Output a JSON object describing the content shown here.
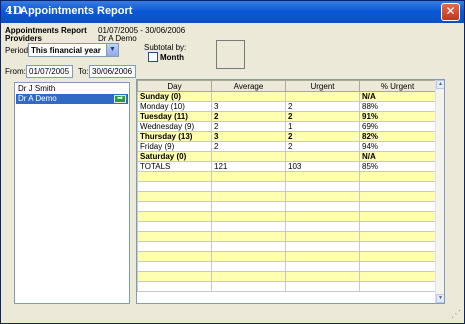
{
  "window": {
    "title": "Appointments Report",
    "logo": "4D"
  },
  "report": {
    "heading": "Appointments Report",
    "date_range": "01/07/2005 - 30/06/2006",
    "providers_label": "Providers",
    "providers_value": "Dr A Demo"
  },
  "period": {
    "label": "Period:",
    "value": "This financial year"
  },
  "subtotal": {
    "label": "Subtotal by:",
    "option": "Month"
  },
  "from": {
    "label": "From:",
    "value": "01/07/2005"
  },
  "to": {
    "label": "To:",
    "value": "30/06/2006"
  },
  "providers": [
    {
      "name": "Dr J Smith",
      "selected": false
    },
    {
      "name": "Dr A Demo",
      "selected": true
    }
  ],
  "grid": {
    "columns": [
      "Day",
      "Average",
      "Urgent",
      "% Urgent"
    ],
    "rows": [
      [
        "Sunday (0)",
        "",
        "",
        "N/A"
      ],
      [
        "Monday (10)",
        "3",
        "2",
        "88%"
      ],
      [
        "Tuesday (11)",
        "2",
        "2",
        "91%"
      ],
      [
        "Wednesday (9)",
        "2",
        "1",
        "69%"
      ],
      [
        "Thursday (13)",
        "3",
        "2",
        "82%"
      ],
      [
        "Friday (9)",
        "2",
        "2",
        "94%"
      ],
      [
        "Saturday (0)",
        "",
        "",
        "N/A"
      ],
      [
        "TOTALS",
        "121",
        "103",
        "85%"
      ]
    ],
    "bold_rows": [
      0,
      2,
      4,
      6
    ]
  },
  "icons": {
    "close": "close-icon",
    "go": "arrow-right-icon",
    "dropdown": "chevron-down-icon",
    "resize": "resize-grip-icon"
  }
}
